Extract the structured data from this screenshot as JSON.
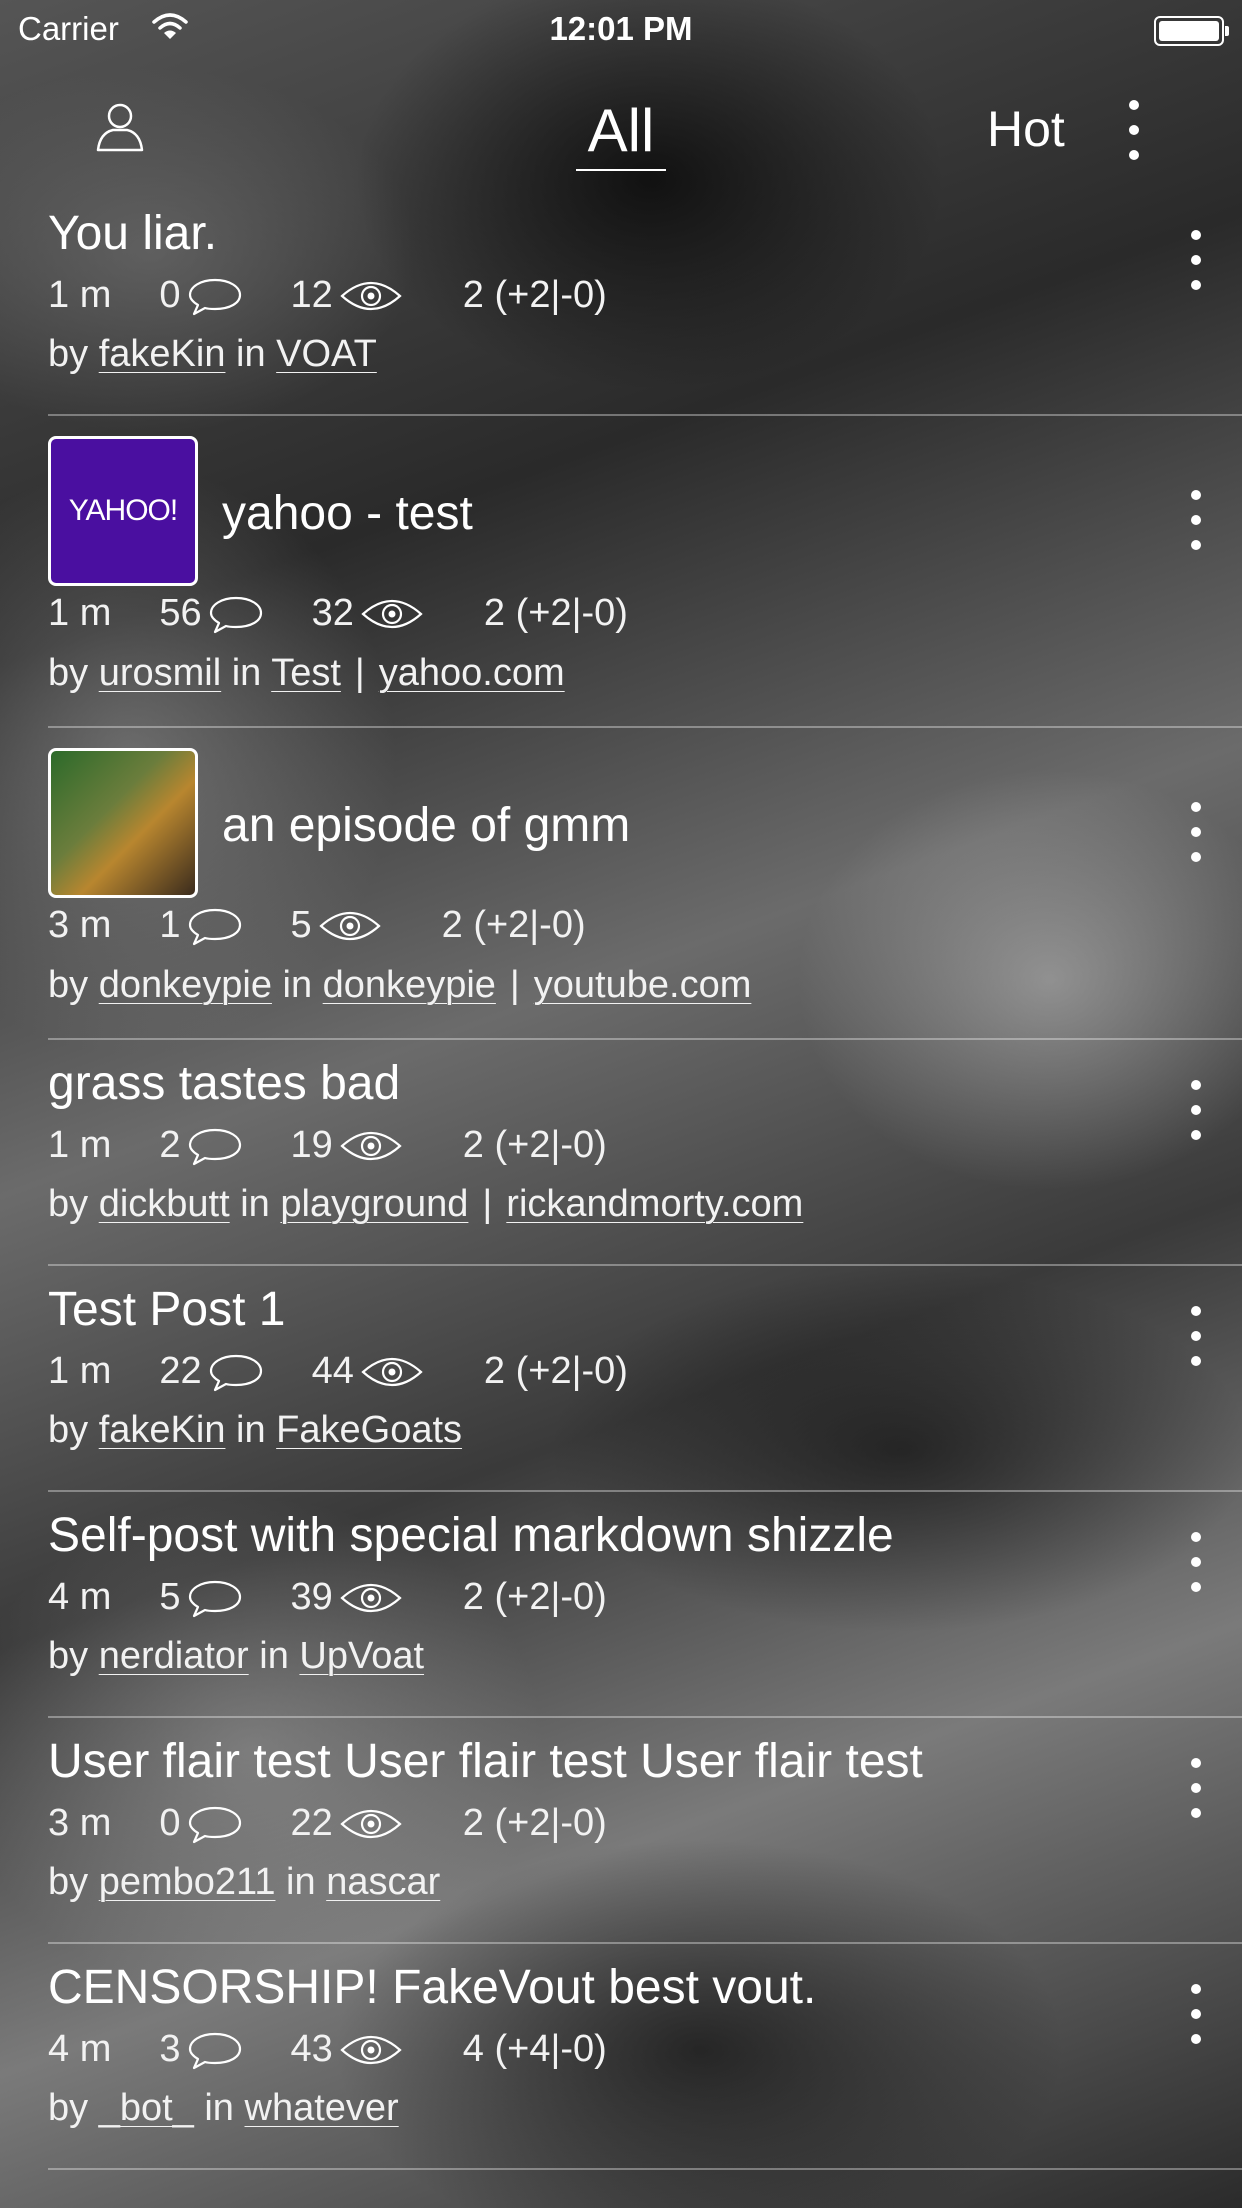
{
  "status_bar": {
    "carrier": "Carrier",
    "time": "12:01 PM"
  },
  "nav": {
    "title": "All",
    "sort": "Hot"
  },
  "posts": [
    {
      "title": "You liar.",
      "age": "1 m",
      "comments": "0",
      "views": "12",
      "score": "2 (+2|-0)",
      "by_label": "by",
      "author": "fakeKin",
      "in_label": "in",
      "sub": "VOAT",
      "domain": "",
      "thumbnail": ""
    },
    {
      "title": "yahoo - test",
      "age": "1 m",
      "comments": "56",
      "views": "32",
      "score": "2 (+2|-0)",
      "by_label": "by",
      "author": "urosmil",
      "in_label": "in",
      "sub": "Test",
      "domain": "yahoo.com",
      "thumbnail": "YAHOO!"
    },
    {
      "title": "an episode of gmm",
      "age": "3 m",
      "comments": "1",
      "views": "5",
      "score": "2 (+2|-0)",
      "by_label": "by",
      "author": "donkeypie",
      "in_label": "in",
      "sub": "donkeypie",
      "domain": "youtube.com",
      "thumbnail": "video"
    },
    {
      "title": "grass tastes bad",
      "age": "1 m",
      "comments": "2",
      "views": "19",
      "score": "2 (+2|-0)",
      "by_label": "by",
      "author": "dickbutt",
      "in_label": "in",
      "sub": "playground",
      "domain": "rickandmorty.com",
      "thumbnail": ""
    },
    {
      "title": "Test Post 1",
      "age": "1 m",
      "comments": "22",
      "views": "44",
      "score": "2 (+2|-0)",
      "by_label": "by",
      "author": "fakeKin",
      "in_label": "in",
      "sub": "FakeGoats",
      "domain": "",
      "thumbnail": ""
    },
    {
      "title": "Self-post with special markdown shizzle",
      "age": "4 m",
      "comments": "5",
      "views": "39",
      "score": "2 (+2|-0)",
      "by_label": "by",
      "author": "nerdiator",
      "in_label": "in",
      "sub": "UpVoat",
      "domain": "",
      "thumbnail": ""
    },
    {
      "title": "User flair test User flair test User flair test",
      "age": "3 m",
      "comments": "0",
      "views": "22",
      "score": "2 (+2|-0)",
      "by_label": "by",
      "author": "pembo211",
      "in_label": "in",
      "sub": "nascar",
      "domain": "",
      "thumbnail": ""
    },
    {
      "title": "CENSORSHIP! FakeVout best vout.",
      "age": "4 m",
      "comments": "3",
      "views": "43",
      "score": "4 (+4|-0)",
      "by_label": "by",
      "author": "_bot_",
      "in_label": "in",
      "sub": "whatever",
      "domain": "",
      "thumbnail": ""
    }
  ],
  "icons": {
    "profile": "person-icon",
    "more": "more-vertical-icon",
    "comments": "comment-bubble-icon",
    "views": "eye-icon",
    "wifi": "wifi-icon",
    "battery": "battery-icon"
  }
}
